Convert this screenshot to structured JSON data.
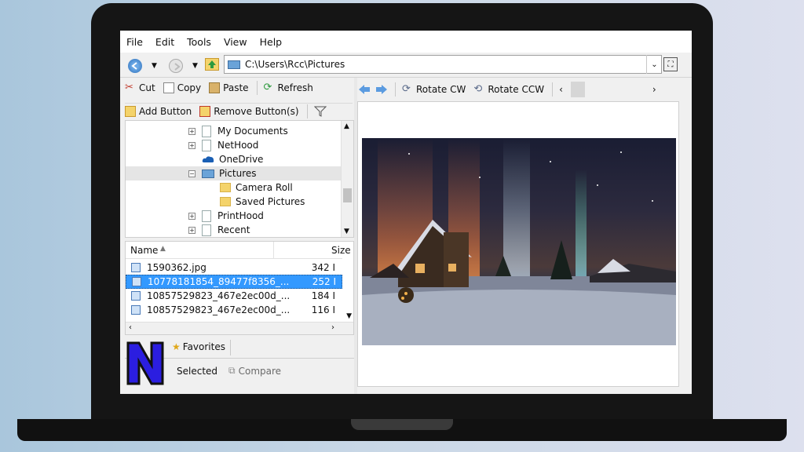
{
  "menu": [
    "File",
    "Edit",
    "Tools",
    "View",
    "Help"
  ],
  "address": {
    "path": "C:\\Users\\Rcc\\Pictures"
  },
  "toolbar": {
    "cut": "Cut",
    "copy": "Copy",
    "paste": "Paste",
    "refresh": "Refresh"
  },
  "buttons_bar": {
    "add": "Add Button",
    "remove": "Remove Button(s)"
  },
  "tree": [
    {
      "label": "My Documents",
      "expander": "+",
      "icon": "document-folder-icon"
    },
    {
      "label": "NetHood",
      "expander": "+",
      "icon": "document-folder-icon"
    },
    {
      "label": "OneDrive",
      "expander": "",
      "icon": "onedrive-cloud-icon"
    },
    {
      "label": "Pictures",
      "expander": "−",
      "icon": "pictures-folder-icon",
      "selected": true
    },
    {
      "label": "Camera Roll",
      "expander": "",
      "icon": "folder-icon",
      "indent": true
    },
    {
      "label": "Saved Pictures",
      "expander": "",
      "icon": "folder-icon",
      "indent": true
    },
    {
      "label": "PrintHood",
      "expander": "+",
      "icon": "document-folder-icon"
    },
    {
      "label": "Recent",
      "expander": "+",
      "icon": "document-folder-icon"
    }
  ],
  "filelist": {
    "col_name": "Name",
    "col_size": "Size",
    "rows": [
      {
        "name": "1590362.jpg",
        "size": "342 I"
      },
      {
        "name": "10778181854_89477f8356_...",
        "size": "252 I",
        "selected": true
      },
      {
        "name": "10857529823_467e2ec00d_...",
        "size": "184 I"
      },
      {
        "name": "10857529823_467e2ec00d_...",
        "size": "116 I"
      }
    ]
  },
  "bottom": {
    "favorites": "Favorites",
    "selected": "Selected",
    "compare": "Compare"
  },
  "preview": {
    "rotate_cw": "Rotate CW",
    "rotate_ccw": "Rotate CCW"
  },
  "colors": {
    "selection": "#3399ff",
    "accent": "#1a5fb4"
  }
}
